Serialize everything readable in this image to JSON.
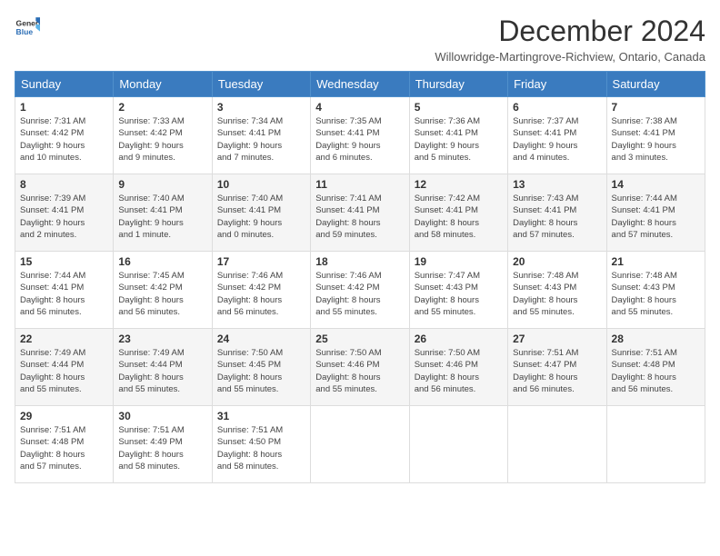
{
  "logo": {
    "general": "General",
    "blue": "Blue"
  },
  "title": "December 2024",
  "subtitle": "Willowridge-Martingrove-Richview, Ontario, Canada",
  "days_header": [
    "Sunday",
    "Monday",
    "Tuesday",
    "Wednesday",
    "Thursday",
    "Friday",
    "Saturday"
  ],
  "weeks": [
    [
      {
        "day": "1",
        "sunrise": "7:31 AM",
        "sunset": "4:42 PM",
        "daylight": "9 hours and 10 minutes."
      },
      {
        "day": "2",
        "sunrise": "7:33 AM",
        "sunset": "4:42 PM",
        "daylight": "9 hours and 9 minutes."
      },
      {
        "day": "3",
        "sunrise": "7:34 AM",
        "sunset": "4:41 PM",
        "daylight": "9 hours and 7 minutes."
      },
      {
        "day": "4",
        "sunrise": "7:35 AM",
        "sunset": "4:41 PM",
        "daylight": "9 hours and 6 minutes."
      },
      {
        "day": "5",
        "sunrise": "7:36 AM",
        "sunset": "4:41 PM",
        "daylight": "9 hours and 5 minutes."
      },
      {
        "day": "6",
        "sunrise": "7:37 AM",
        "sunset": "4:41 PM",
        "daylight": "9 hours and 4 minutes."
      },
      {
        "day": "7",
        "sunrise": "7:38 AM",
        "sunset": "4:41 PM",
        "daylight": "9 hours and 3 minutes."
      }
    ],
    [
      {
        "day": "8",
        "sunrise": "7:39 AM",
        "sunset": "4:41 PM",
        "daylight": "9 hours and 2 minutes."
      },
      {
        "day": "9",
        "sunrise": "7:40 AM",
        "sunset": "4:41 PM",
        "daylight": "9 hours and 1 minute."
      },
      {
        "day": "10",
        "sunrise": "7:40 AM",
        "sunset": "4:41 PM",
        "daylight": "9 hours and 0 minutes."
      },
      {
        "day": "11",
        "sunrise": "7:41 AM",
        "sunset": "4:41 PM",
        "daylight": "8 hours and 59 minutes."
      },
      {
        "day": "12",
        "sunrise": "7:42 AM",
        "sunset": "4:41 PM",
        "daylight": "8 hours and 58 minutes."
      },
      {
        "day": "13",
        "sunrise": "7:43 AM",
        "sunset": "4:41 PM",
        "daylight": "8 hours and 57 minutes."
      },
      {
        "day": "14",
        "sunrise": "7:44 AM",
        "sunset": "4:41 PM",
        "daylight": "8 hours and 57 minutes."
      }
    ],
    [
      {
        "day": "15",
        "sunrise": "7:44 AM",
        "sunset": "4:41 PM",
        "daylight": "8 hours and 56 minutes."
      },
      {
        "day": "16",
        "sunrise": "7:45 AM",
        "sunset": "4:42 PM",
        "daylight": "8 hours and 56 minutes."
      },
      {
        "day": "17",
        "sunrise": "7:46 AM",
        "sunset": "4:42 PM",
        "daylight": "8 hours and 56 minutes."
      },
      {
        "day": "18",
        "sunrise": "7:46 AM",
        "sunset": "4:42 PM",
        "daylight": "8 hours and 55 minutes."
      },
      {
        "day": "19",
        "sunrise": "7:47 AM",
        "sunset": "4:43 PM",
        "daylight": "8 hours and 55 minutes."
      },
      {
        "day": "20",
        "sunrise": "7:48 AM",
        "sunset": "4:43 PM",
        "daylight": "8 hours and 55 minutes."
      },
      {
        "day": "21",
        "sunrise": "7:48 AM",
        "sunset": "4:43 PM",
        "daylight": "8 hours and 55 minutes."
      }
    ],
    [
      {
        "day": "22",
        "sunrise": "7:49 AM",
        "sunset": "4:44 PM",
        "daylight": "8 hours and 55 minutes."
      },
      {
        "day": "23",
        "sunrise": "7:49 AM",
        "sunset": "4:44 PM",
        "daylight": "8 hours and 55 minutes."
      },
      {
        "day": "24",
        "sunrise": "7:50 AM",
        "sunset": "4:45 PM",
        "daylight": "8 hours and 55 minutes."
      },
      {
        "day": "25",
        "sunrise": "7:50 AM",
        "sunset": "4:46 PM",
        "daylight": "8 hours and 55 minutes."
      },
      {
        "day": "26",
        "sunrise": "7:50 AM",
        "sunset": "4:46 PM",
        "daylight": "8 hours and 56 minutes."
      },
      {
        "day": "27",
        "sunrise": "7:51 AM",
        "sunset": "4:47 PM",
        "daylight": "8 hours and 56 minutes."
      },
      {
        "day": "28",
        "sunrise": "7:51 AM",
        "sunset": "4:48 PM",
        "daylight": "8 hours and 56 minutes."
      }
    ],
    [
      {
        "day": "29",
        "sunrise": "7:51 AM",
        "sunset": "4:48 PM",
        "daylight": "8 hours and 57 minutes."
      },
      {
        "day": "30",
        "sunrise": "7:51 AM",
        "sunset": "4:49 PM",
        "daylight": "8 hours and 58 minutes."
      },
      {
        "day": "31",
        "sunrise": "7:51 AM",
        "sunset": "4:50 PM",
        "daylight": "8 hours and 58 minutes."
      },
      null,
      null,
      null,
      null
    ]
  ]
}
